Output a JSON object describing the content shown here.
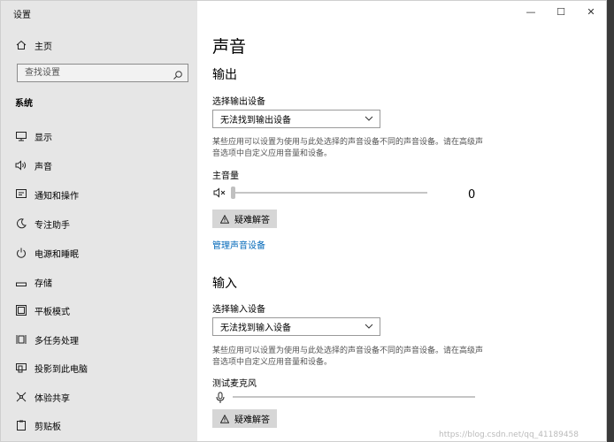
{
  "window": {
    "title": "设置",
    "minimize": "—",
    "maximize": "☐",
    "close": "✕"
  },
  "sidebar": {
    "home": "主页",
    "search_placeholder": "查找设置",
    "section": "系统",
    "items": [
      {
        "label": "显示",
        "icon": "monitor-icon"
      },
      {
        "label": "声音",
        "icon": "speaker-icon"
      },
      {
        "label": "通知和操作",
        "icon": "notification-icon"
      },
      {
        "label": "专注助手",
        "icon": "moon-icon"
      },
      {
        "label": "电源和睡眠",
        "icon": "power-icon"
      },
      {
        "label": "存储",
        "icon": "storage-icon"
      },
      {
        "label": "平板模式",
        "icon": "tablet-icon"
      },
      {
        "label": "多任务处理",
        "icon": "multitask-icon"
      },
      {
        "label": "投影到此电脑",
        "icon": "project-icon"
      },
      {
        "label": "体验共享",
        "icon": "share-icon"
      },
      {
        "label": "剪贴板",
        "icon": "clipboard-icon"
      }
    ]
  },
  "main": {
    "title": "声音",
    "output": {
      "heading": "输出",
      "select_label": "选择输出设备",
      "select_value": "无法找到输出设备",
      "desc": "某些应用可以设置为使用与此处选择的声音设备不同的声音设备。请在高级声音选项中自定义应用音量和设备。",
      "volume_label": "主音量",
      "volume_value": "0",
      "troubleshoot": "疑难解答",
      "manage_link": "管理声音设备"
    },
    "input": {
      "heading": "输入",
      "select_label": "选择输入设备",
      "select_value": "无法找到输入设备",
      "desc": "某些应用可以设置为使用与此处选择的声音设备不同的声音设备。请在高级声音选项中自定义应用音量和设备。",
      "mic_label": "测试麦克风",
      "troubleshoot": "疑难解答"
    }
  },
  "watermark": "https://blog.csdn.net/qq_41189458"
}
